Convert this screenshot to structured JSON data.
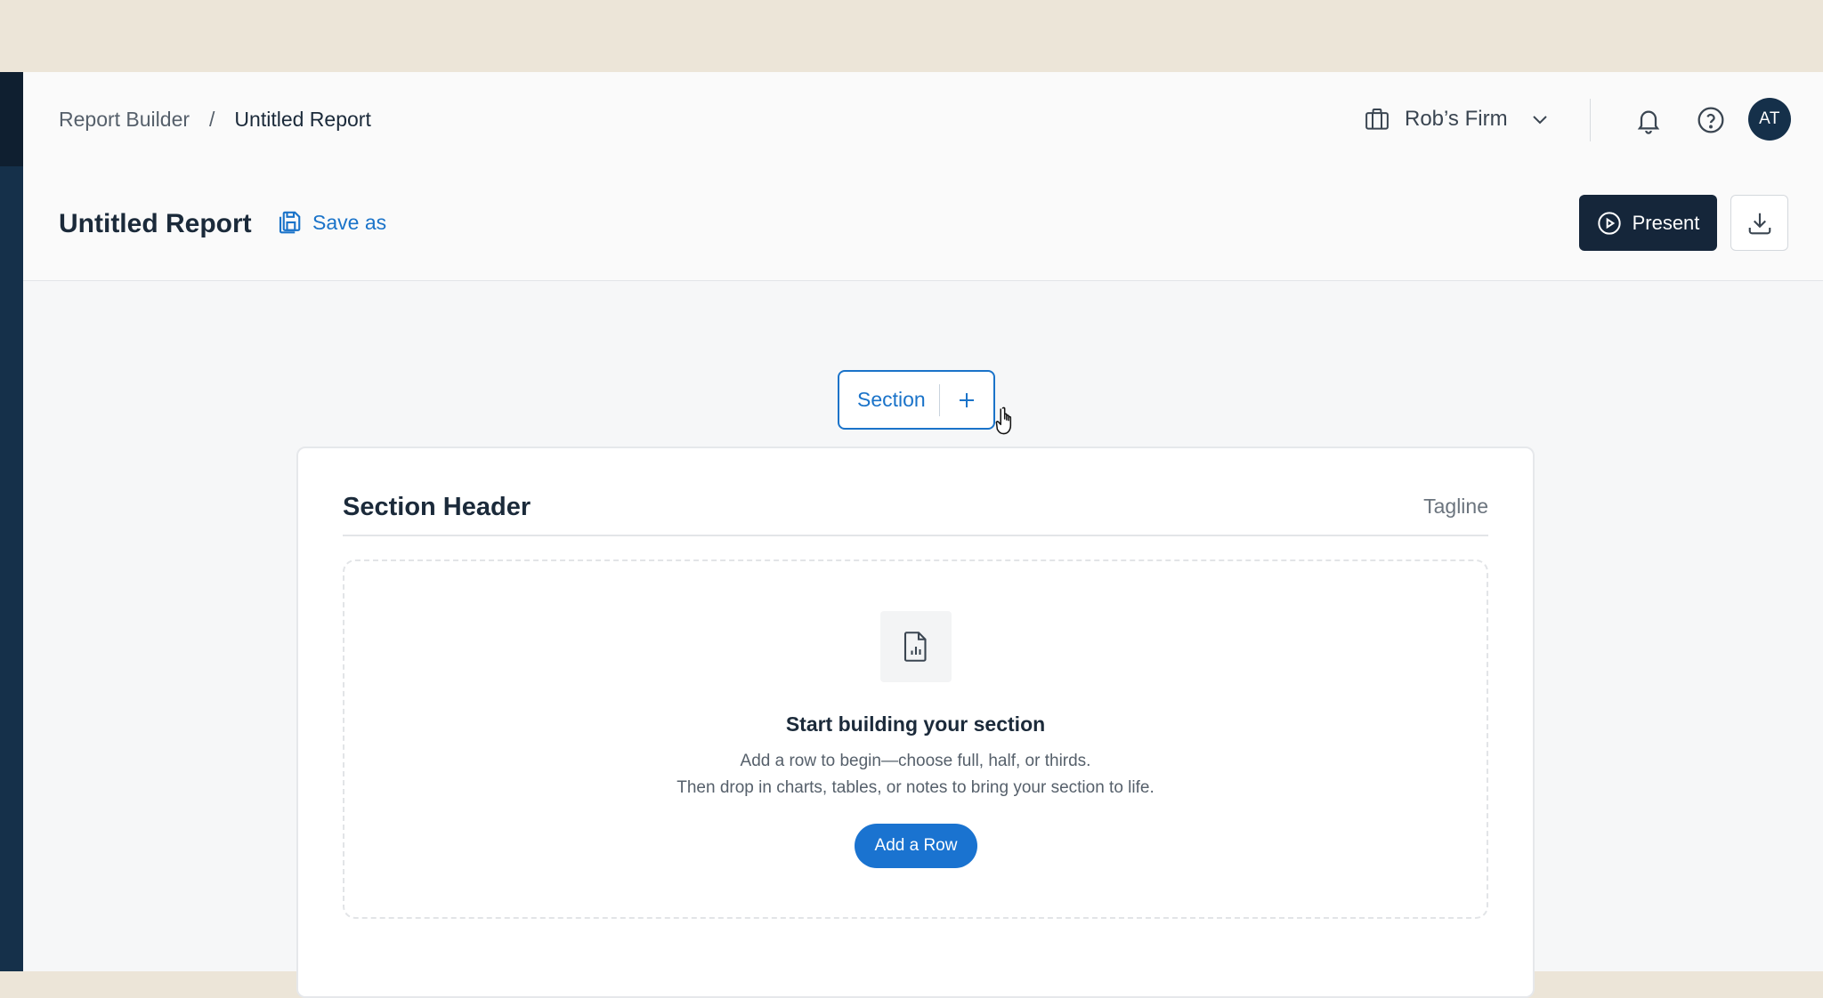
{
  "breadcrumb": {
    "parent": "Report Builder",
    "separator": "/",
    "current": "Untitled Report"
  },
  "header": {
    "firm_name": "Rob’s Firm",
    "avatar_initials": "AT"
  },
  "report": {
    "title": "Untitled Report",
    "save_as_label": "Save as",
    "present_label": "Present"
  },
  "section_toolbar": {
    "label": "Section"
  },
  "section": {
    "header": "Section Header",
    "tagline": "Tagline",
    "empty_title": "Start building your section",
    "empty_line_1": "Add a row to begin—choose full, half, or thirds.",
    "empty_line_2": "Then drop in charts, tables, or notes to bring your section to life.",
    "add_row_label": "Add a Row"
  },
  "colors": {
    "accent": "#1a73c9",
    "navy": "#15263a",
    "top_band": "#ece5d8"
  },
  "icons": [
    "briefcase-icon",
    "chevron-down-icon",
    "bell-icon",
    "help-icon",
    "save-icon",
    "play-icon",
    "download-icon",
    "plus-icon",
    "report-chart-icon",
    "hand-cursor-icon"
  ]
}
